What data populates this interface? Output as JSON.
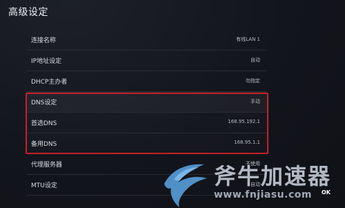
{
  "header": {
    "title": "高级设定"
  },
  "rows": [
    {
      "label": "连接名称",
      "value": "有线LAN 1"
    },
    {
      "label": "IP地址设定",
      "value": "自动"
    },
    {
      "label": "DHCP主办者",
      "value": "勿指定"
    },
    {
      "label": "DNS设定",
      "value": "手动"
    },
    {
      "label": "首选DNS",
      "value": "168.95.192.1"
    },
    {
      "label": "备用DNS",
      "value": "168.95.1.1"
    },
    {
      "label": "代理服务器",
      "value": "不使用"
    },
    {
      "label": "MTU设定",
      "value": "自动"
    }
  ],
  "watermark": {
    "title": "斧牛加速器",
    "url": "www.fnjiasu.com"
  },
  "footer": {
    "ok_label": "OK"
  },
  "colors": {
    "highlight_border": "#c8202a",
    "background": "#12141b"
  }
}
